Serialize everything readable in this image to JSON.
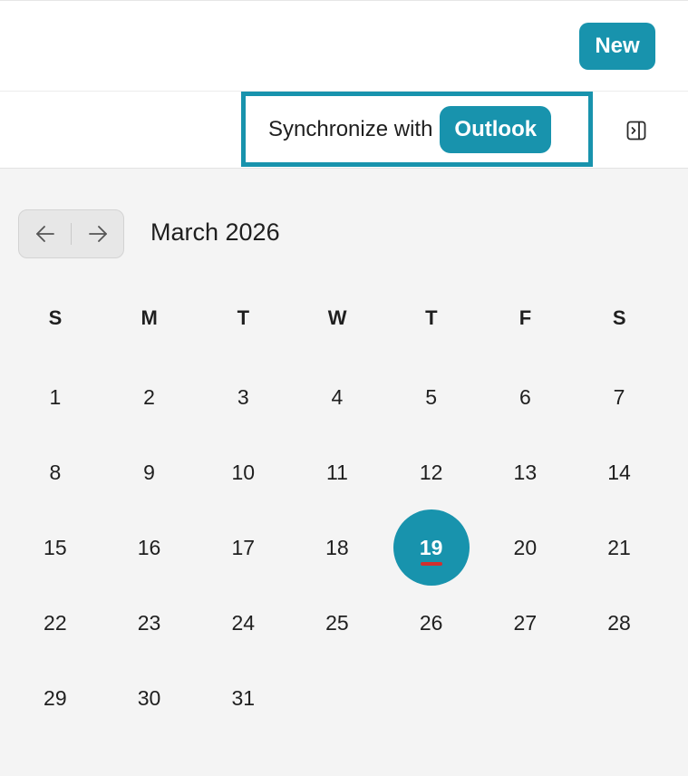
{
  "header": {
    "new_label": "New"
  },
  "toolbar": {
    "sync_label": "Synchronize with",
    "outlook_label": "Outlook",
    "panel_icon": "panel-toggle-icon"
  },
  "calendar": {
    "month_title": "March 2026",
    "prev_icon": "arrow-left-icon",
    "next_icon": "arrow-right-icon",
    "weekdays": [
      "S",
      "M",
      "T",
      "W",
      "T",
      "F",
      "S"
    ],
    "weeks": [
      [
        "1",
        "2",
        "3",
        "4",
        "5",
        "6",
        "7"
      ],
      [
        "8",
        "9",
        "10",
        "11",
        "12",
        "13",
        "14"
      ],
      [
        "15",
        "16",
        "17",
        "18",
        "19",
        "20",
        "21"
      ],
      [
        "22",
        "23",
        "24",
        "25",
        "26",
        "27",
        "28"
      ],
      [
        "29",
        "30",
        "31",
        "",
        "",
        "",
        ""
      ]
    ],
    "today": "19"
  },
  "colors": {
    "accent": "#1893ad",
    "today_underline": "#d22f2f",
    "calendar_background": "#f4f4f4"
  }
}
